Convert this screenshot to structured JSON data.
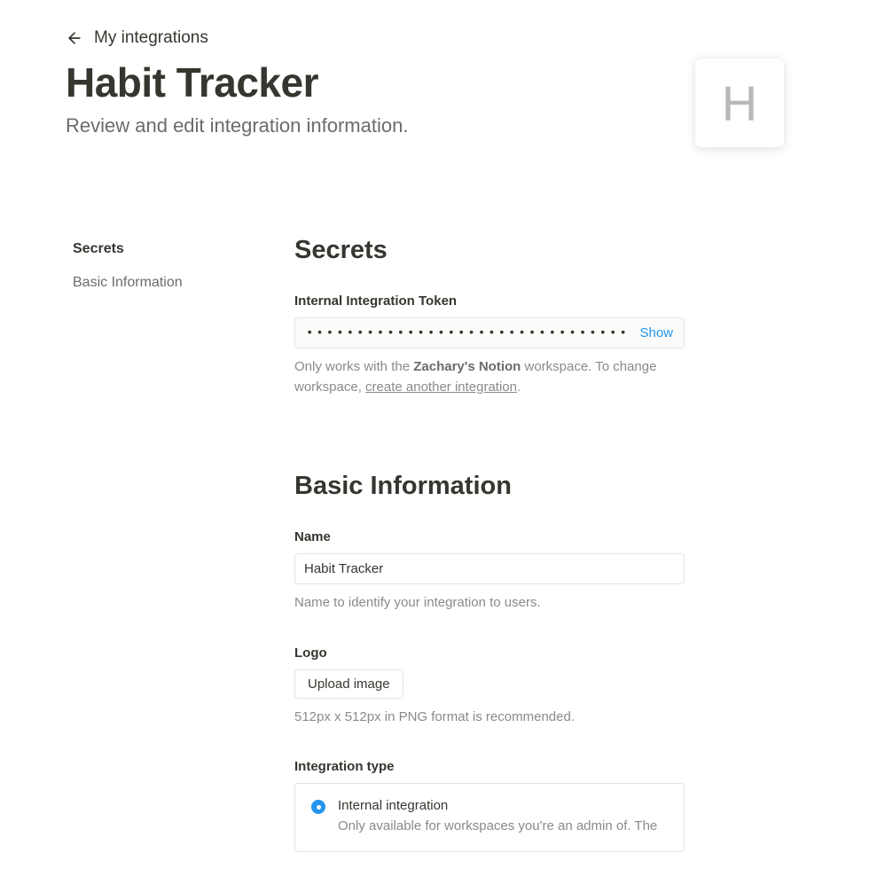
{
  "breadcrumb": {
    "label": "My integrations"
  },
  "header": {
    "title": "Habit Tracker",
    "subtitle": "Review and edit integration information.",
    "logo_letter": "H"
  },
  "sidebar": {
    "items": [
      {
        "label": "Secrets",
        "active": true
      },
      {
        "label": "Basic Information",
        "active": false
      }
    ]
  },
  "secrets": {
    "heading": "Secrets",
    "token": {
      "label": "Internal Integration Token",
      "masked": "••••••••••••••••••••••••••••••••••••••••••••",
      "show_label": "Show"
    },
    "help": {
      "prefix": "Only works with the ",
      "workspace": "Zachary's Notion",
      "middle": " workspace. To change workspace, ",
      "link": "create another integration",
      "suffix": "."
    }
  },
  "basic": {
    "heading": "Basic Information",
    "name": {
      "label": "Name",
      "value": "Habit Tracker",
      "help": "Name to identify your integration to users."
    },
    "logo": {
      "label": "Logo",
      "button": "Upload image",
      "help": "512px x 512px in PNG format is recommended."
    },
    "type": {
      "label": "Integration type",
      "option": {
        "title": "Internal integration",
        "desc": "Only available for workspaces you're an admin of. The"
      }
    }
  }
}
